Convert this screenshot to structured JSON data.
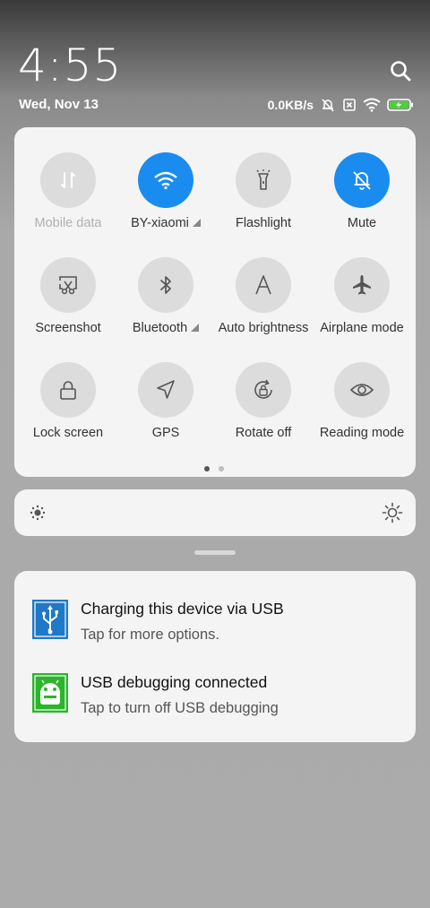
{
  "header": {
    "time": "4:55",
    "date": "Wed, Nov 13",
    "net_speed": "0.0KB/s",
    "icons": [
      "search-icon",
      "alarm-off-icon",
      "no-sim-icon",
      "wifi-icon",
      "battery-charging-icon"
    ]
  },
  "tiles": [
    {
      "label": "Mobile data",
      "icon": "mobile-data-icon",
      "active": false,
      "disabled": true
    },
    {
      "label": "BY-xiaomi",
      "icon": "wifi-icon",
      "active": true,
      "expand": true
    },
    {
      "label": "Flashlight",
      "icon": "flashlight-icon",
      "active": false
    },
    {
      "label": "Mute",
      "icon": "bell-off-icon",
      "active": true
    },
    {
      "label": "Screenshot",
      "icon": "screenshot-icon",
      "active": false
    },
    {
      "label": "Bluetooth",
      "icon": "bluetooth-icon",
      "active": false,
      "expand": true
    },
    {
      "label": "Auto brightness",
      "icon": "auto-brightness-icon",
      "active": false
    },
    {
      "label": "Airplane mode",
      "icon": "airplane-icon",
      "active": false
    },
    {
      "label": "Lock screen",
      "icon": "lock-icon",
      "active": false
    },
    {
      "label": "GPS",
      "icon": "gps-icon",
      "active": false
    },
    {
      "label": "Rotate off",
      "icon": "rotate-lock-icon",
      "active": false
    },
    {
      "label": "Reading mode",
      "icon": "eye-icon",
      "active": false
    }
  ],
  "pager": {
    "pages": 2,
    "current": 1
  },
  "brightness": {
    "low_icon": "brightness-low-icon",
    "high_icon": "brightness-high-icon"
  },
  "notifications": [
    {
      "title": "Charging this device via USB",
      "subtitle": "Tap for more options.",
      "icon": "usb-icon",
      "icon_color": "#1f78c8"
    },
    {
      "title": "USB debugging connected",
      "subtitle": "Tap to turn off USB debugging",
      "icon": "android-debug-icon",
      "icon_color": "#2bb52b"
    }
  ],
  "colors": {
    "accent": "#1a8cf0",
    "tile_off": "#dcdcdc",
    "panel": "#f4f4f4"
  }
}
